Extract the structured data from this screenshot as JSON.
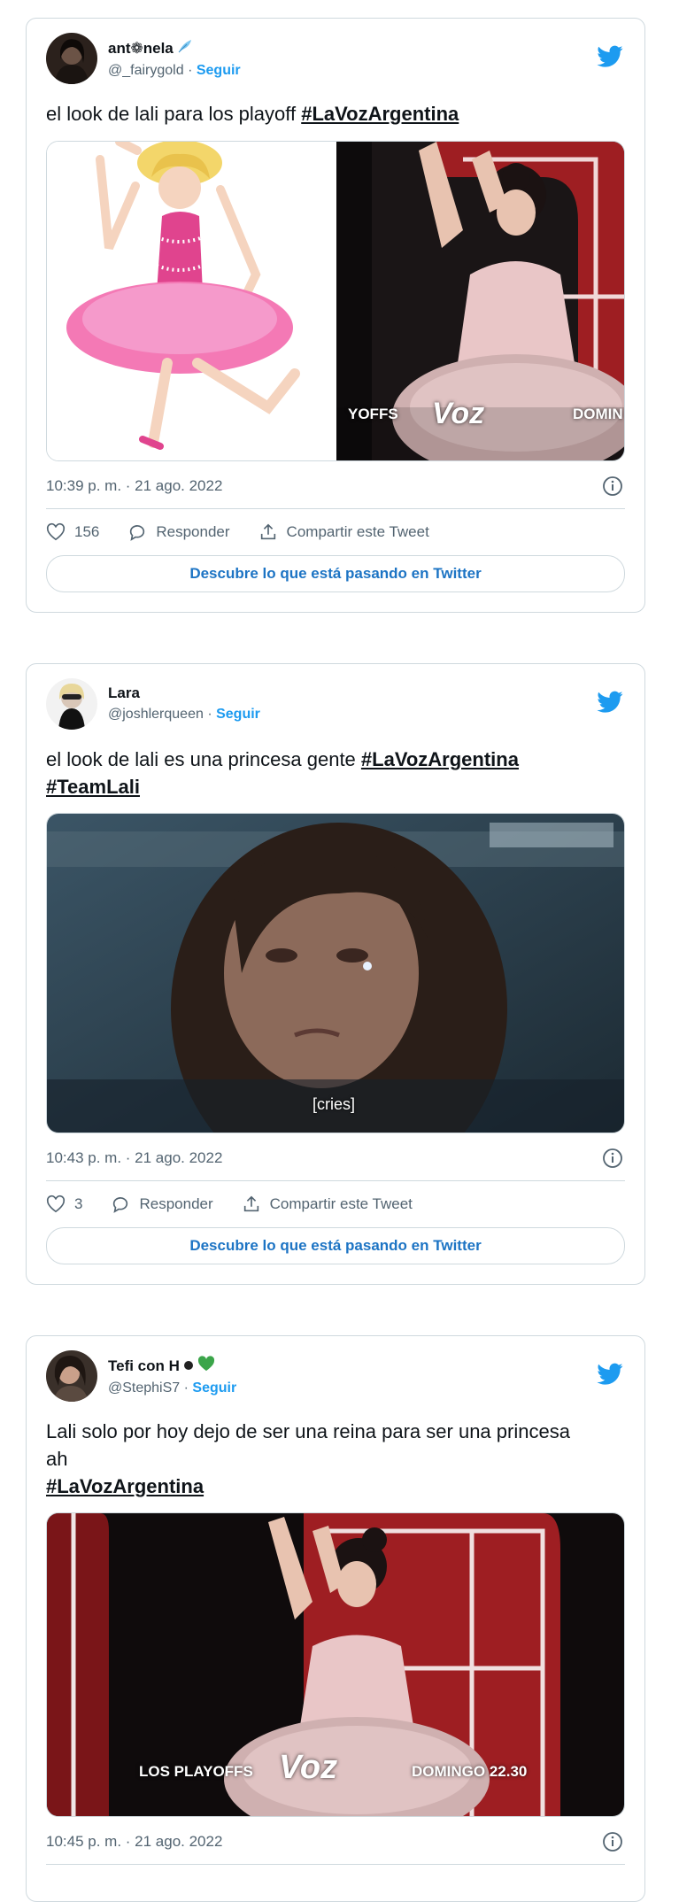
{
  "colors": {
    "accent": "#1d9bf0",
    "text": "#0f1419",
    "muted": "#536471",
    "border": "#cfd9de",
    "heart_green": "#3ba54a"
  },
  "tweets": [
    {
      "display_name": "ant❁nela",
      "name_emoji": "feather",
      "handle": "@_fairygold",
      "follow": "Seguir",
      "separator": "·",
      "text_plain": "el look de lali para los playoff ",
      "hashtags": [
        "#LaVozArgentina"
      ],
      "overlay_left": "YOFFS",
      "overlay_right": "DOMIN",
      "logo": "Voz",
      "timestamp": "10:39 p. m. · 21 ago. 2022",
      "likes": "156",
      "reply": "Responder",
      "share": "Compartir este Tweet",
      "cta": "Descubre lo que está pasando en Twitter"
    },
    {
      "display_name": "Lara",
      "handle": "@joshlerqueen",
      "follow": "Seguir",
      "separator": "·",
      "text_plain": "el look de lali es una princesa gente ",
      "hashtags": [
        "#LaVozArgentina",
        "#TeamLali"
      ],
      "caption": "[cries]",
      "timestamp": "10:43 p. m. · 21 ago. 2022",
      "likes": "3",
      "reply": "Responder",
      "share": "Compartir este Tweet",
      "cta": "Descubre lo que está pasando en Twitter"
    },
    {
      "display_name": "Tefi con H",
      "name_emoji": "green-heart",
      "handle": "@StephiS7",
      "follow": "Seguir",
      "separator": "·",
      "text_plain": "Lali solo por hoy dejo de ser una reina para ser una princesa ah",
      "hashtags": [
        "#LaVozArgentina"
      ],
      "overlay_left": "LOS PLAYOFFS",
      "overlay_right": "DOMINGO 22.30",
      "logo": "Voz",
      "timestamp": "10:45 p. m. · 21 ago. 2022"
    }
  ]
}
